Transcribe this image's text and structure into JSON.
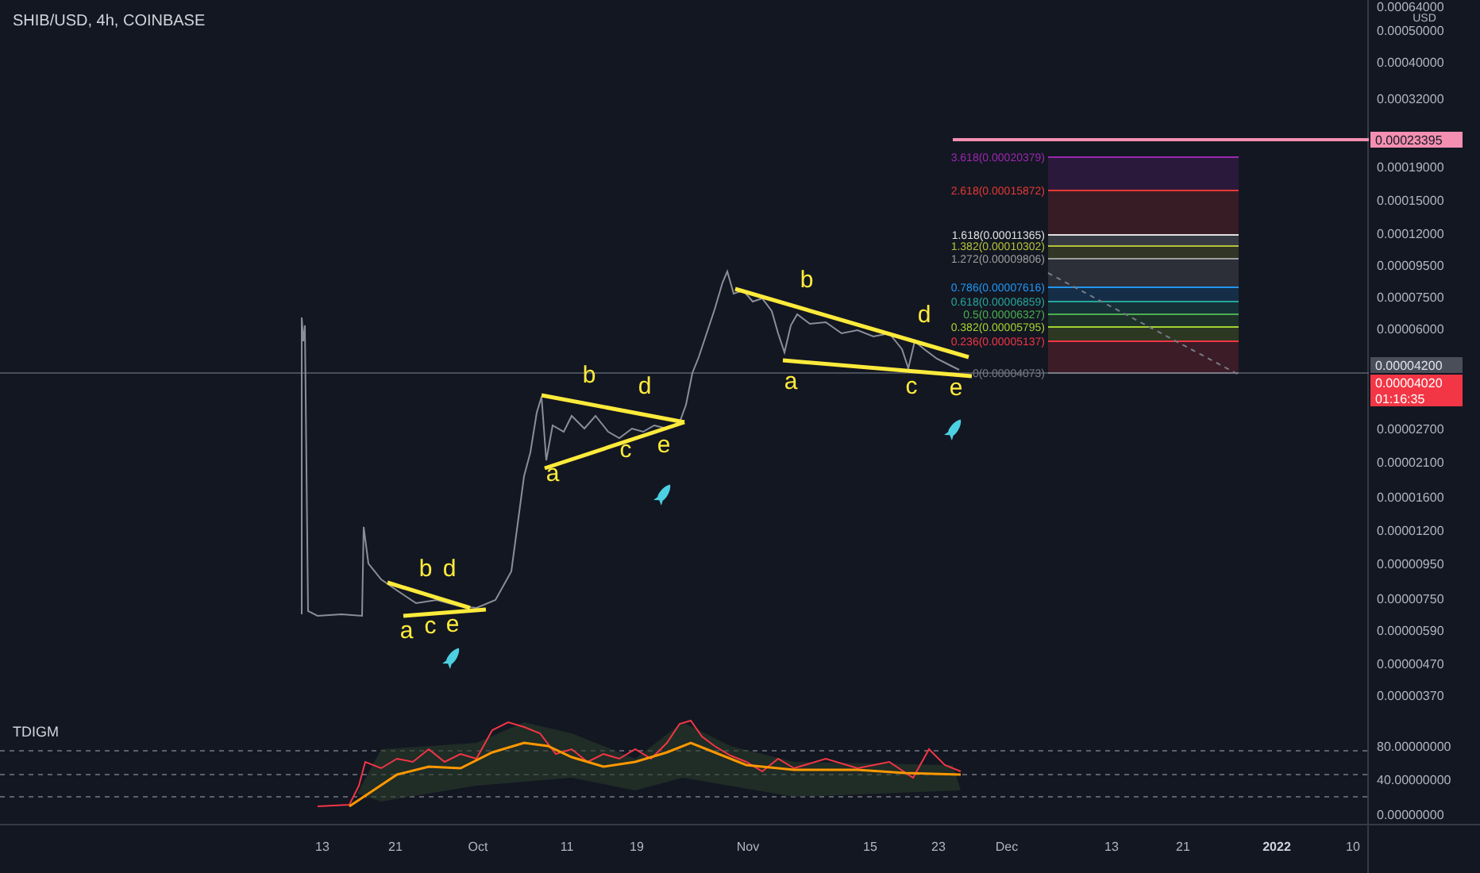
{
  "header": {
    "title": "SHIB/USD, 4h, COINBASE"
  },
  "price_axis": {
    "unit": "USD",
    "ticks": [
      "0.00064000",
      "0.00050000",
      "0.00040000",
      "0.00032000",
      "0.00019000",
      "0.00015000",
      "0.00012000",
      "0.00009500",
      "0.00007500",
      "0.00006000",
      "0.00002700",
      "0.00002100",
      "0.00001600",
      "0.00001200",
      "0.00000950",
      "0.00000750",
      "0.00000590",
      "0.00000470",
      "0.00000370"
    ]
  },
  "price_badges": [
    {
      "kind": "target",
      "value": "0.00023395"
    },
    {
      "kind": "crosshair",
      "value": "0.00004200"
    },
    {
      "kind": "last",
      "value": "0.00004020",
      "countdown": "01:16:35"
    }
  ],
  "fib_levels": [
    {
      "label": "3.618(0.00020379)",
      "color": "#9c27b0"
    },
    {
      "label": "2.618(0.00015872)",
      "color": "#e53935"
    },
    {
      "label": "1.618(0.00011365)",
      "color": "#e0e0e0"
    },
    {
      "label": "1.382(0.00010302)",
      "color": "#b5c23a"
    },
    {
      "label": "1.272(0.00009806)",
      "color": "#9e9e9e"
    },
    {
      "label": "0.786(0.00007616)",
      "color": "#2196f3"
    },
    {
      "label": "0.618(0.00006859)",
      "color": "#26a69a"
    },
    {
      "label": "0.5(0.00006327)",
      "color": "#4caf50"
    },
    {
      "label": "0.382(0.00005795)",
      "color": "#a5d12f"
    },
    {
      "label": "0.236(0.00005137)",
      "color": "#f23645"
    },
    {
      "label": "0(0.00004073)",
      "color": "#787b86"
    }
  ],
  "patterns": [
    {
      "labels": [
        "a",
        "b",
        "c",
        "d",
        "e"
      ]
    },
    {
      "labels": [
        "a",
        "b",
        "c",
        "d",
        "e"
      ]
    },
    {
      "labels": [
        "a",
        "b",
        "c",
        "d",
        "e"
      ]
    }
  ],
  "indicator": {
    "title": "TDIGM",
    "ticks": [
      "80.00000000",
      "40.00000000",
      "0.00000000"
    ]
  },
  "time_axis": {
    "ticks": [
      {
        "label": "13",
        "kind": "day"
      },
      {
        "label": "21",
        "kind": "day"
      },
      {
        "label": "Oct",
        "kind": "month"
      },
      {
        "label": "11",
        "kind": "day"
      },
      {
        "label": "19",
        "kind": "day"
      },
      {
        "label": "Nov",
        "kind": "month"
      },
      {
        "label": "15",
        "kind": "day"
      },
      {
        "label": "23",
        "kind": "day"
      },
      {
        "label": "Dec",
        "kind": "month"
      },
      {
        "label": "13",
        "kind": "day"
      },
      {
        "label": "21",
        "kind": "day"
      },
      {
        "label": "2022",
        "kind": "year"
      },
      {
        "label": "10",
        "kind": "day"
      }
    ]
  }
}
